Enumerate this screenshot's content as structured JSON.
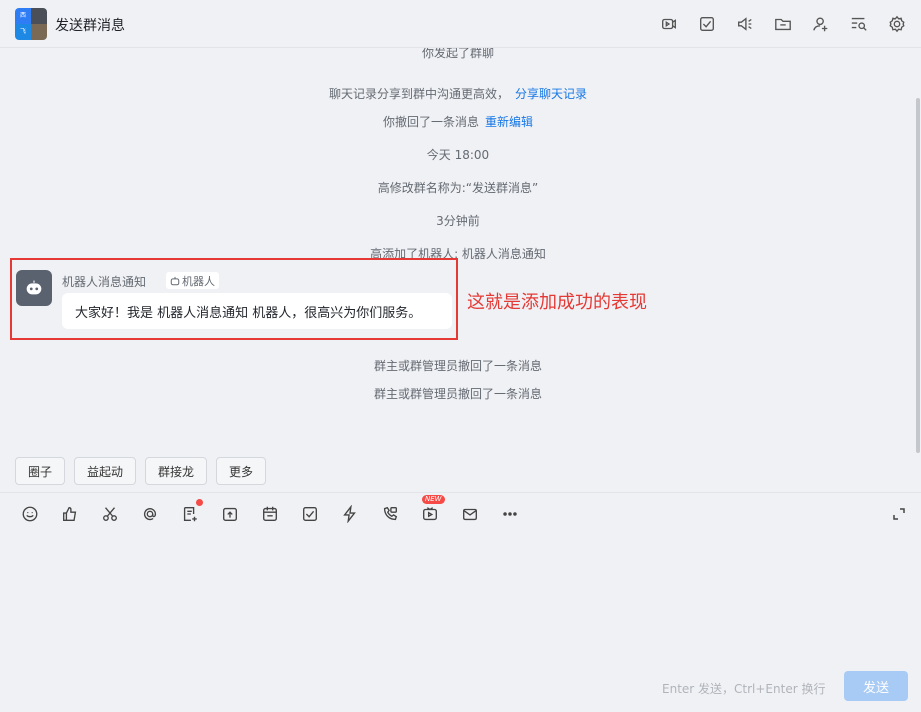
{
  "header": {
    "title": "发送群消息",
    "avatar_chars": [
      "西",
      "飞"
    ],
    "icons": [
      "video-icon",
      "task-check-icon",
      "speaker-icon",
      "folder-icon",
      "add-member-icon",
      "search-history-icon",
      "settings-icon"
    ]
  },
  "chat": {
    "sys_partial": "你发起了群聊",
    "sys_share": "聊天记录分享到群中沟通更高效，",
    "sys_share_link": "分享聊天记录",
    "sys_recall": "你撤回了一条消息",
    "sys_recall_link": "重新编辑",
    "time_today": "今天 18:00",
    "rename": "高修改群名称为:“发送群消息”",
    "time_ago": "3分钟前",
    "bot_added": "高添加了机器人: 机器人消息通知",
    "recall1": "群主或群管理员撤回了一条消息",
    "recall2": "群主或群管理员撤回了一条消息"
  },
  "bot_message": {
    "sender": "机器人消息通知",
    "tag": "机器人",
    "text": "大家好！我是 机器人消息通知 机器人，很高兴为你们服务。"
  },
  "annotation": "这就是添加成功的表现",
  "quick_actions": [
    "圈子",
    "益起动",
    "群接龙",
    "更多"
  ],
  "toolbar_icons": [
    "emoji-icon",
    "thumbs-up-icon",
    "scissors-icon",
    "at-icon",
    "doc-add-icon",
    "upload-icon",
    "calendar-icon",
    "task-icon",
    "lightning-icon",
    "phone-icon",
    "live-icon",
    "mail-icon",
    "more-icon"
  ],
  "toolbar_badge": "NEW",
  "composer": {
    "hint": "Enter 发送，Ctrl+Enter 换行",
    "send_label": "发送"
  },
  "colors": {
    "accent": "#1677e6",
    "annotation_red": "#e53935",
    "send_disabled": "#a8cbf5"
  }
}
